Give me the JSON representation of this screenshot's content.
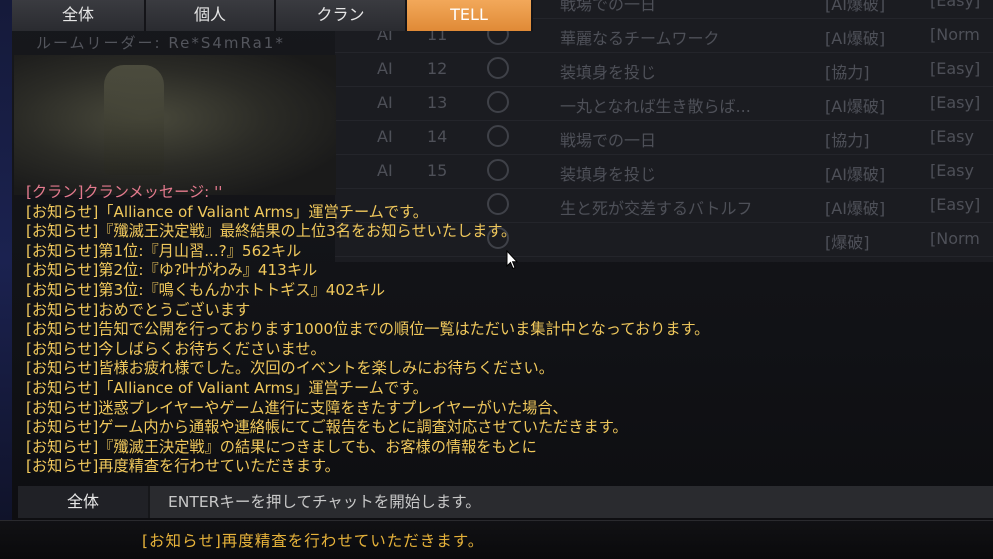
{
  "tabs": [
    {
      "label": "全体",
      "active": false
    },
    {
      "label": "個人",
      "active": false
    },
    {
      "label": "クラン",
      "active": false
    },
    {
      "label": "TELL",
      "active": true
    }
  ],
  "room_leader": "ルームリーダー: Re*S4mRa1*",
  "room_list": [
    {
      "type": "",
      "num": "",
      "title": "戦場での一日",
      "mode": "[AI爆破]",
      "diff": "[Easy]"
    },
    {
      "type": "AI",
      "num": "11",
      "title": "華麗なるチームワーク",
      "mode": "[AI爆破]",
      "diff": "[Norm"
    },
    {
      "type": "AI",
      "num": "12",
      "title": "装填身を投じ",
      "mode": "[協力]",
      "diff": "[Easy]"
    },
    {
      "type": "AI",
      "num": "13",
      "title": "一丸となれば生き散らば...",
      "mode": "[AI爆破]",
      "diff": "[Easy]"
    },
    {
      "type": "AI",
      "num": "14",
      "title": "戦場での一日",
      "mode": "[協力]",
      "diff": "[Easy"
    },
    {
      "type": "AI",
      "num": "15",
      "title": "装填身を投じ",
      "mode": "[AI爆破]",
      "diff": "[Easy"
    },
    {
      "type": "",
      "num": "",
      "title": "生と死が交差するバトルフ",
      "mode": "[AI爆破]",
      "diff": "[Easy]"
    },
    {
      "type": "",
      "num": "",
      "title": "",
      "mode": "[爆破]",
      "diff": "[Norm"
    }
  ],
  "chat_messages": [
    {
      "text": "[クラン]クランメッセージ: ''",
      "kind": "clan"
    },
    {
      "text": "[お知らせ]「Alliance of Valiant Arms」運営チームです。",
      "kind": "notice"
    },
    {
      "text": "[お知らせ]『殲滅王決定戦』最終結果の上位3名をお知らせいたします。",
      "kind": "notice"
    },
    {
      "text": "[お知らせ]第1位:『月山習...?』562キル",
      "kind": "notice"
    },
    {
      "text": "[お知らせ]第2位:『ゆ?叶がわみ』413キル",
      "kind": "notice"
    },
    {
      "text": "[お知らせ]第3位:『鳴くもんかホトトギス』402キル",
      "kind": "notice"
    },
    {
      "text": "[お知らせ]おめでとうございます",
      "kind": "notice"
    },
    {
      "text": "[お知らせ]告知で公開を行っております1000位までの順位一覧はただいま集計中となっております。",
      "kind": "notice"
    },
    {
      "text": "[お知らせ]今しばらくお待ちくださいませ。",
      "kind": "notice"
    },
    {
      "text": "[お知らせ]皆様お疲れ様でした。次回のイベントを楽しみにお待ちください。",
      "kind": "notice"
    },
    {
      "text": "[お知らせ]「Alliance of Valiant Arms」運営チームです。",
      "kind": "notice"
    },
    {
      "text": "[お知らせ]迷惑プレイヤーやゲーム進行に支障をきたすプレイヤーがいた場合、",
      "kind": "notice"
    },
    {
      "text": "[お知らせ]ゲーム内から通報や連絡帳にてご報告をもとに調査対応させていただきます。",
      "kind": "notice"
    },
    {
      "text": "[お知らせ]『殲滅王決定戦』の結果につきましても、お客様の情報をもとに",
      "kind": "notice"
    },
    {
      "text": "[お知らせ]再度精査を行わせていただきます。",
      "kind": "notice"
    }
  ],
  "input": {
    "channel_label": "全体",
    "placeholder": "ENTERキーを押してチャットを開始します。"
  },
  "ticker": {
    "text": "[お知らせ]再度精査を行わせていただきます。"
  },
  "colors": {
    "notice": "#f0c85c",
    "clan": "#e47a8e",
    "active_tab": "#e08a36"
  }
}
